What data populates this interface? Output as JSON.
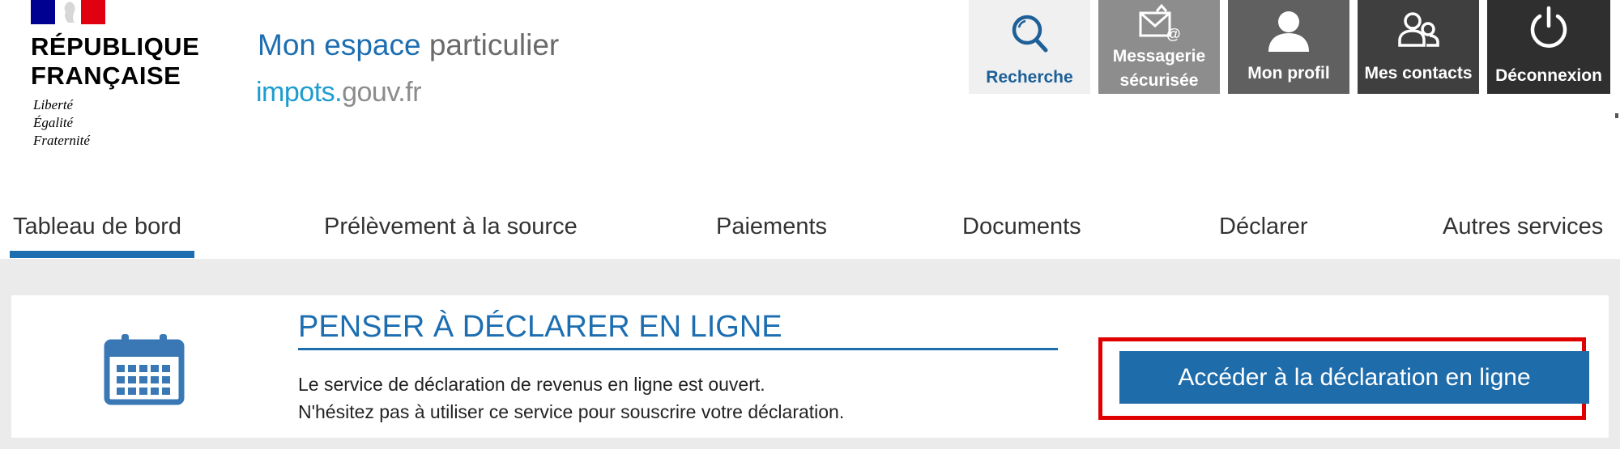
{
  "header": {
    "logo": {
      "line1": "RÉPUBLIQUE",
      "line2": "FRANÇAISE",
      "motto": [
        "Liberté",
        "Égalité",
        "Fraternité"
      ]
    },
    "site_title": {
      "part1": "Mon espace",
      "part2": " particulier"
    },
    "site_subtitle": {
      "part1": "impots.",
      "part2": "gouv.fr"
    },
    "toolbar": [
      {
        "label": "Recherche",
        "icon": "search-icon"
      },
      {
        "label_line1": "Messagerie",
        "label_line2": "sécurisée",
        "icon": "secure-mail-icon"
      },
      {
        "label": "Mon profil",
        "icon": "user-icon"
      },
      {
        "label": "Mes contacts",
        "icon": "contacts-icon"
      },
      {
        "label": "Déconnexion",
        "icon": "power-icon"
      }
    ]
  },
  "nav": {
    "items": [
      {
        "label": "Tableau de bord",
        "active": true
      },
      {
        "label": "Prélèvement à la source",
        "active": false
      },
      {
        "label": "Paiements",
        "active": false
      },
      {
        "label": "Documents",
        "active": false
      },
      {
        "label": "Déclarer",
        "active": false
      },
      {
        "label": "Autres services",
        "active": false
      }
    ]
  },
  "notice": {
    "icon": "calendar-icon",
    "title": "PENSER À DÉCLARER EN LIGNE",
    "text_line1": "Le service de déclaration de revenus en ligne est ouvert.",
    "text_line2": "N'hésitez pas à utiliser ce service pour souscrire votre déclaration.",
    "cta_label": "Accéder à la déclaration en ligne"
  },
  "colors": {
    "accent_blue": "#1d6eb1",
    "cta_blue": "#1f6cab",
    "highlight_red": "#e00000",
    "flag_blue": "#000091",
    "flag_red": "#e1000f"
  }
}
